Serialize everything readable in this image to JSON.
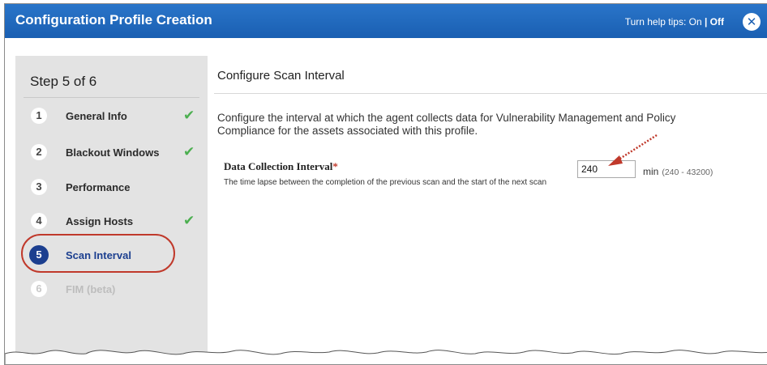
{
  "window": {
    "title": "Configuration Profile Creation",
    "help_prefix": "Turn help tips: ",
    "help_on": "On",
    "help_sep": " | ",
    "help_off": "Off",
    "close_icon": "close-icon"
  },
  "sidebar": {
    "step_header": "Step 5 of 6",
    "steps": [
      {
        "num": "1",
        "label": "General Info",
        "done": true
      },
      {
        "num": "2",
        "label": "Blackout Windows",
        "done": true
      },
      {
        "num": "3",
        "label": "Performance",
        "done": false
      },
      {
        "num": "4",
        "label": "Assign Hosts",
        "done": true
      },
      {
        "num": "5",
        "label": "Scan Interval",
        "done": false,
        "active": true
      },
      {
        "num": "6",
        "label": "FIM (beta)",
        "done": false,
        "disabled": true
      }
    ],
    "check_glyph": "✔"
  },
  "main": {
    "title": "Configure Scan Interval",
    "description": "Configure the interval at which the agent collects data for Vulnerability Management and Policy Compliance for the assets associated with this profile.",
    "field_label": "Data Collection Interval",
    "required_mark": "*",
    "field_help": "The time lapse between the completion of the previous scan and the start of the next scan",
    "interval_value": "240",
    "unit": "min",
    "range": "(240 - 43200)"
  },
  "colors": {
    "titlebar": "#1a5fb2",
    "active_step": "#1c3f8f",
    "check": "#4caf50",
    "annotation": "#c0392b"
  }
}
